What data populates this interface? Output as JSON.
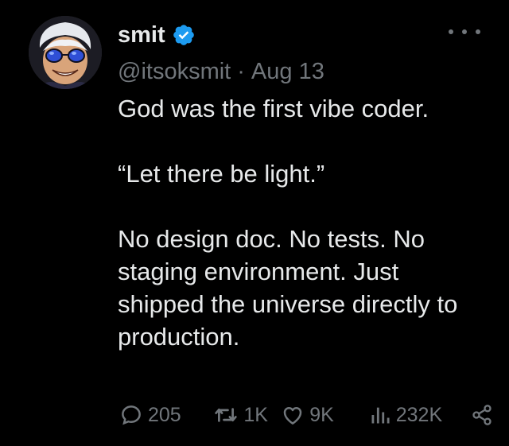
{
  "tweet": {
    "author": {
      "display_name": "smit",
      "handle": "@itsoksmit",
      "verified": true,
      "avatar_icon": "avatar-image"
    },
    "separator": "·",
    "date": "Aug 13",
    "body": [
      "God was the first vibe coder.",
      "“Let there be light.”",
      "No design doc. No tests. No staging environment. Just shipped the universe directly to production."
    ],
    "stats": {
      "replies": "205",
      "retweets": "1K",
      "likes": "9K",
      "views": "232K"
    },
    "icons": {
      "verified": "verified-badge-icon",
      "more": "more-dots-icon",
      "reply": "reply-bubble-icon",
      "retweet": "retweet-icon",
      "like": "heart-icon",
      "views": "views-bar-chart-icon",
      "share": "share-icon"
    },
    "colors": {
      "background": "#000000",
      "text": "#e7e9ea",
      "muted": "#71767b",
      "verified_blue": "#1d9bf0"
    }
  }
}
